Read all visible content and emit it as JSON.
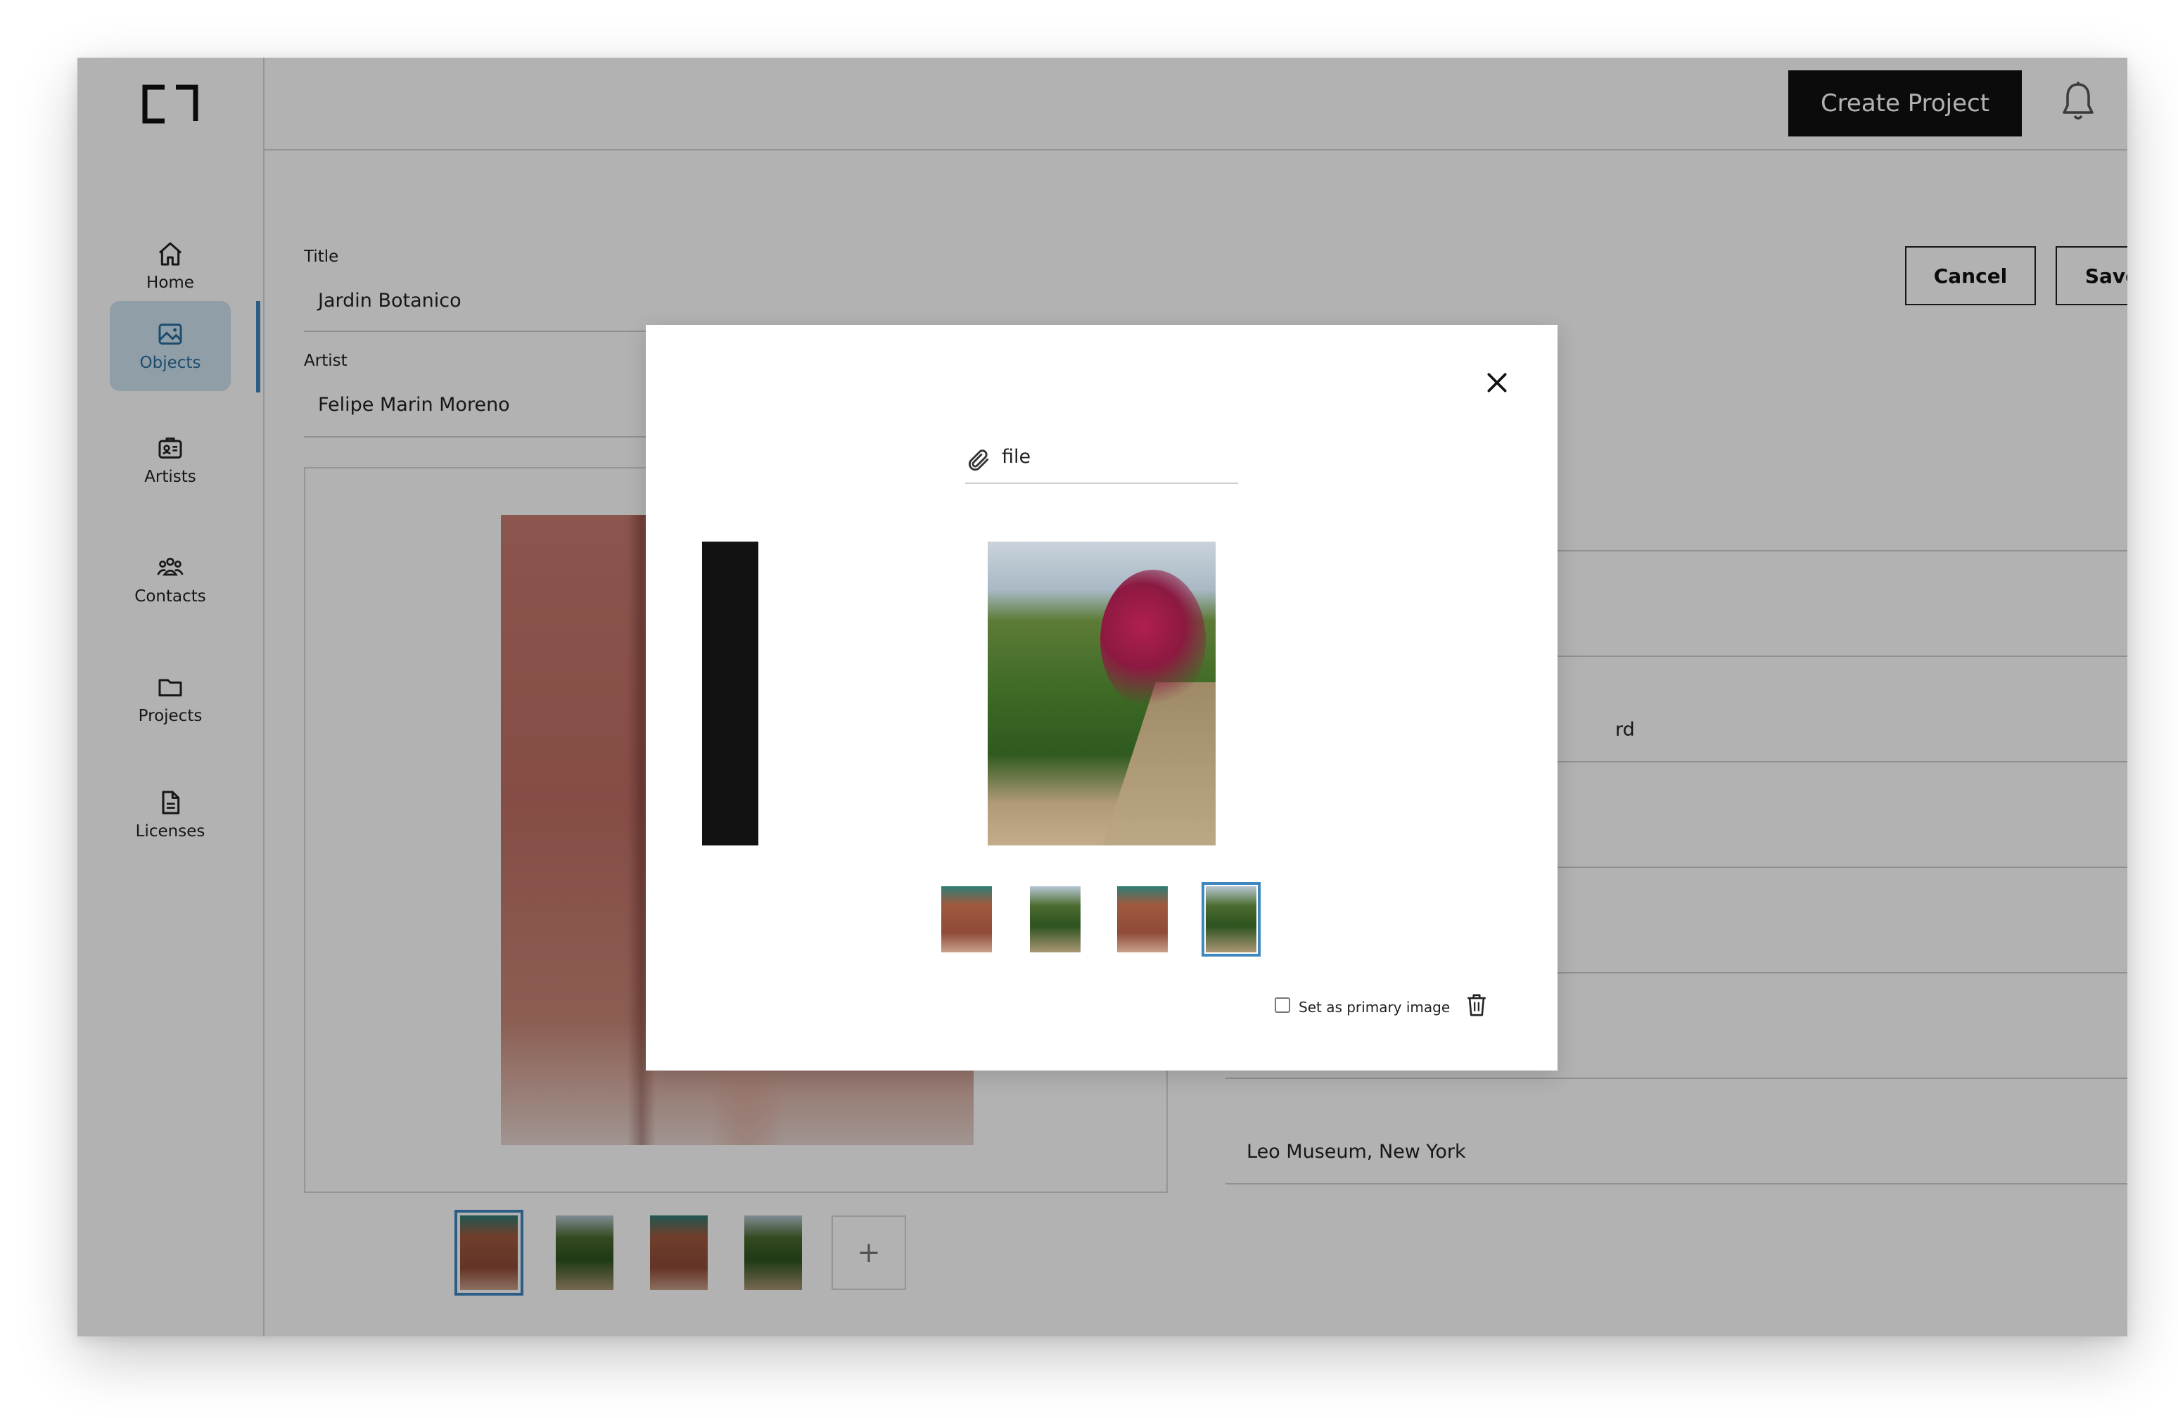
{
  "header": {
    "create_project_label": "Create Project"
  },
  "sidebar": {
    "items": [
      {
        "label": "Home",
        "icon": "home-icon"
      },
      {
        "label": "Objects",
        "icon": "image-icon",
        "active": true
      },
      {
        "label": "Artists",
        "icon": "id-card-icon"
      },
      {
        "label": "Contacts",
        "icon": "people-icon"
      },
      {
        "label": "Projects",
        "icon": "folder-icon"
      },
      {
        "label": "Licenses",
        "icon": "document-icon"
      }
    ]
  },
  "form": {
    "title_label": "Title",
    "title_value": "Jardin Botanico",
    "artist_label": "Artist",
    "artist_value": "Felipe Marin Moreno",
    "partial_value": "rd",
    "location_value": "Leo Museum, New York"
  },
  "actions": {
    "cancel_label": "Cancel",
    "save_label": "Save"
  },
  "gallery": {
    "add_label": "+"
  },
  "modal": {
    "file_placeholder": "file",
    "primary_label": "Set as primary image",
    "primary_checked": false
  },
  "colors": {
    "accent": "#3f87bf",
    "nav_active_bg": "#cfe3f1",
    "primary_button": "#111111"
  }
}
